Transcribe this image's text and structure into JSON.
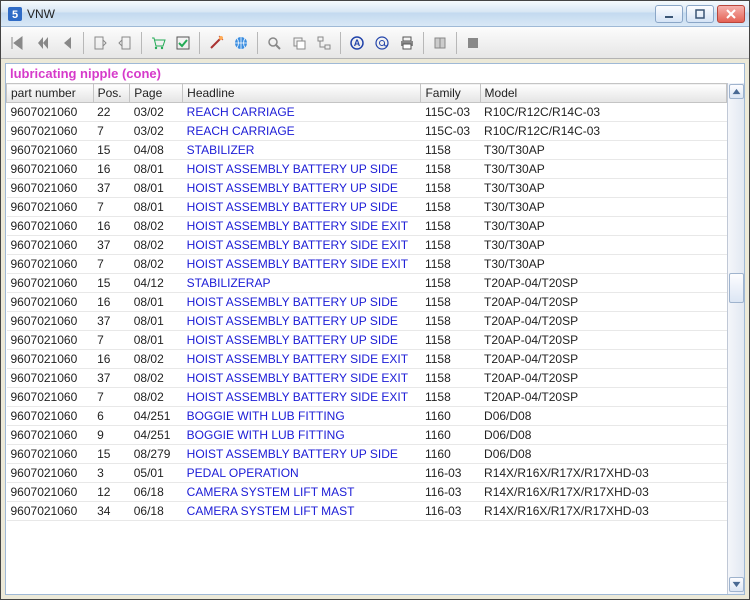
{
  "window": {
    "title": "VNW"
  },
  "part_title": "lubricating nipple (cone)",
  "columns": {
    "part": "part number",
    "pos": "Pos.",
    "page": "Page",
    "head": "Headline",
    "fam": "Family",
    "model": "Model"
  },
  "rows": [
    {
      "part": "9607021060",
      "pos": "22",
      "page": "03/02",
      "head": "REACH CARRIAGE",
      "fam": "115C-03",
      "model": "R10C/R12C/R14C-03"
    },
    {
      "part": "9607021060",
      "pos": "7",
      "page": "03/02",
      "head": "REACH CARRIAGE",
      "fam": "115C-03",
      "model": "R10C/R12C/R14C-03"
    },
    {
      "part": "9607021060",
      "pos": "15",
      "page": "04/08",
      "head": "STABILIZER",
      "fam": "1158",
      "model": "T30/T30AP"
    },
    {
      "part": "9607021060",
      "pos": "16",
      "page": "08/01",
      "head": "HOIST ASSEMBLY BATTERY UP SIDE",
      "fam": "1158",
      "model": "T30/T30AP"
    },
    {
      "part": "9607021060",
      "pos": "37",
      "page": "08/01",
      "head": "HOIST ASSEMBLY BATTERY UP SIDE",
      "fam": "1158",
      "model": "T30/T30AP"
    },
    {
      "part": "9607021060",
      "pos": "7",
      "page": "08/01",
      "head": "HOIST ASSEMBLY BATTERY UP SIDE",
      "fam": "1158",
      "model": "T30/T30AP"
    },
    {
      "part": "9607021060",
      "pos": "16",
      "page": "08/02",
      "head": "HOIST ASSEMBLY BATTERY SIDE EXIT",
      "fam": "1158",
      "model": "T30/T30AP"
    },
    {
      "part": "9607021060",
      "pos": "37",
      "page": "08/02",
      "head": "HOIST ASSEMBLY BATTERY SIDE EXIT",
      "fam": "1158",
      "model": "T30/T30AP"
    },
    {
      "part": "9607021060",
      "pos": "7",
      "page": "08/02",
      "head": "HOIST ASSEMBLY BATTERY SIDE EXIT",
      "fam": "1158",
      "model": "T30/T30AP"
    },
    {
      "part": "9607021060",
      "pos": "15",
      "page": "04/12",
      "head": "STABILIZERAP",
      "fam": "1158",
      "model": "T20AP-04/T20SP"
    },
    {
      "part": "9607021060",
      "pos": "16",
      "page": "08/01",
      "head": "HOIST ASSEMBLY BATTERY UP SIDE",
      "fam": "1158",
      "model": "T20AP-04/T20SP"
    },
    {
      "part": "9607021060",
      "pos": "37",
      "page": "08/01",
      "head": "HOIST ASSEMBLY BATTERY UP SIDE",
      "fam": "1158",
      "model": "T20AP-04/T20SP"
    },
    {
      "part": "9607021060",
      "pos": "7",
      "page": "08/01",
      "head": "HOIST ASSEMBLY BATTERY UP SIDE",
      "fam": "1158",
      "model": "T20AP-04/T20SP"
    },
    {
      "part": "9607021060",
      "pos": "16",
      "page": "08/02",
      "head": "HOIST ASSEMBLY BATTERY SIDE EXIT",
      "fam": "1158",
      "model": "T20AP-04/T20SP"
    },
    {
      "part": "9607021060",
      "pos": "37",
      "page": "08/02",
      "head": "HOIST ASSEMBLY BATTERY SIDE EXIT",
      "fam": "1158",
      "model": "T20AP-04/T20SP"
    },
    {
      "part": "9607021060",
      "pos": "7",
      "page": "08/02",
      "head": "HOIST ASSEMBLY BATTERY SIDE EXIT",
      "fam": "1158",
      "model": "T20AP-04/T20SP"
    },
    {
      "part": "9607021060",
      "pos": "6",
      "page": "04/251",
      "head": "BOGGIE WITH LUB FITTING",
      "fam": "1160",
      "model": "D06/D08"
    },
    {
      "part": "9607021060",
      "pos": "9",
      "page": "04/251",
      "head": "BOGGIE WITH LUB FITTING",
      "fam": "1160",
      "model": "D06/D08"
    },
    {
      "part": "9607021060",
      "pos": "15",
      "page": "08/279",
      "head": "HOIST ASSEMBLY BATTERY UP SIDE",
      "fam": "1160",
      "model": "D06/D08"
    },
    {
      "part": "9607021060",
      "pos": "3",
      "page": "05/01",
      "head": "PEDAL OPERATION",
      "fam": "116-03",
      "model": "R14X/R16X/R17X/R17XHD-03"
    },
    {
      "part": "9607021060",
      "pos": "12",
      "page": "06/18",
      "head": "CAMERA SYSTEM LIFT MAST",
      "fam": "116-03",
      "model": "R14X/R16X/R17X/R17XHD-03"
    },
    {
      "part": "9607021060",
      "pos": "34",
      "page": "06/18",
      "head": "CAMERA SYSTEM LIFT MAST",
      "fam": "116-03",
      "model": "R14X/R16X/R17X/R17XHD-03"
    }
  ],
  "toolbar_icons": [
    "nav-first",
    "nav-prev-page",
    "nav-prev",
    "sep",
    "doc-left",
    "doc-right",
    "sep",
    "cart",
    "check",
    "sep",
    "wand",
    "globe",
    "sep",
    "zoom",
    "dupe",
    "tree",
    "sep",
    "a-circled",
    "at-sign",
    "print",
    "sep",
    "book",
    "sep",
    "stop"
  ]
}
